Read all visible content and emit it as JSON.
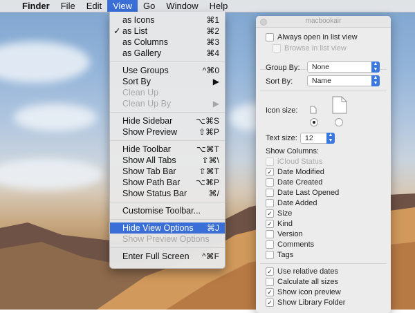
{
  "menubar": {
    "apple": "",
    "app": "Finder",
    "items": [
      "File",
      "Edit",
      "View",
      "Go",
      "Window",
      "Help"
    ],
    "active": "View"
  },
  "view_menu": {
    "items": [
      {
        "label": "as Icons",
        "shortcut": "⌘1"
      },
      {
        "label": "as List",
        "shortcut": "⌘2",
        "checked": "✓"
      },
      {
        "label": "as Columns",
        "shortcut": "⌘3"
      },
      {
        "label": "as Gallery",
        "shortcut": "⌘4"
      },
      {
        "label": "Use Groups",
        "shortcut": "^⌘0"
      },
      {
        "label": "Sort By",
        "shortcut": "▶"
      },
      {
        "label": "Clean Up",
        "shortcut": ""
      },
      {
        "label": "Clean Up By",
        "shortcut": "▶"
      },
      {
        "label": "Hide Sidebar",
        "shortcut": "⌥⌘S"
      },
      {
        "label": "Show Preview",
        "shortcut": "⇧⌘P"
      },
      {
        "label": "Hide Toolbar",
        "shortcut": "⌥⌘T"
      },
      {
        "label": "Show All Tabs",
        "shortcut": "⇧⌘\\"
      },
      {
        "label": "Show Tab Bar",
        "shortcut": "⇧⌘T"
      },
      {
        "label": "Show Path Bar",
        "shortcut": "⌥⌘P"
      },
      {
        "label": "Show Status Bar",
        "shortcut": "⌘/"
      },
      {
        "label": "Customise Toolbar...",
        "shortcut": ""
      },
      {
        "label": "Hide View Options",
        "shortcut": "⌘J"
      },
      {
        "label": "Show Preview Options",
        "shortcut": ""
      },
      {
        "label": "Enter Full Screen",
        "shortcut": "^⌘F"
      }
    ]
  },
  "view_options": {
    "window_title": "macbookair",
    "always_open_list": "Always open in list view",
    "browse_list": "Browse in list view",
    "group_by_label": "Group By:",
    "group_by_value": "None",
    "sort_by_label": "Sort By:",
    "sort_by_value": "Name",
    "icon_size_label": "Icon size:",
    "text_size_label": "Text size:",
    "text_size_value": "12",
    "show_columns_label": "Show Columns:",
    "columns": [
      {
        "label": "iCloud Status",
        "checked": "",
        "disabled": true
      },
      {
        "label": "Date Modified",
        "checked": "✓"
      },
      {
        "label": "Date Created",
        "checked": ""
      },
      {
        "label": "Date Last Opened",
        "checked": ""
      },
      {
        "label": "Date Added",
        "checked": ""
      },
      {
        "label": "Size",
        "checked": "✓"
      },
      {
        "label": "Kind",
        "checked": "✓"
      },
      {
        "label": "Version",
        "checked": ""
      },
      {
        "label": "Comments",
        "checked": ""
      },
      {
        "label": "Tags",
        "checked": ""
      }
    ],
    "options": [
      {
        "label": "Use relative dates",
        "checked": "✓"
      },
      {
        "label": "Calculate all sizes",
        "checked": ""
      },
      {
        "label": "Show icon preview",
        "checked": "✓"
      },
      {
        "label": "Show Library Folder",
        "checked": "✓"
      }
    ]
  },
  "colors": {
    "highlight": "#3a6fd8"
  }
}
